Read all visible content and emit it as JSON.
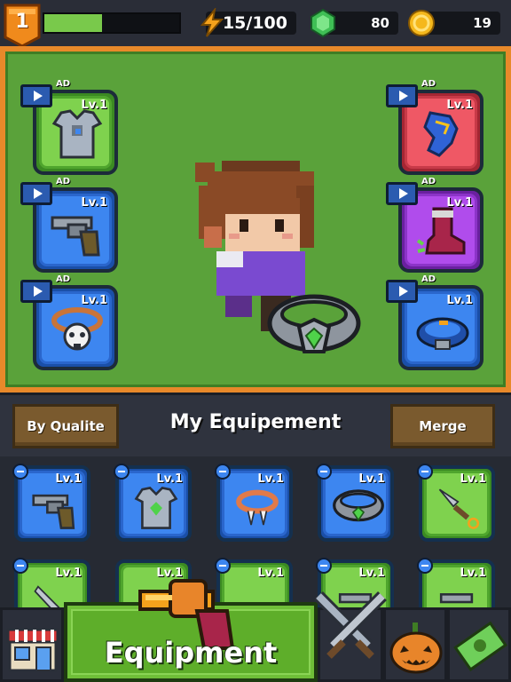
{
  "player": {
    "level": "1",
    "xp_progress": 0.43
  },
  "resources": {
    "energy": {
      "value": "15/100",
      "icon": "lightning-icon"
    },
    "gems": {
      "value": "80",
      "icon": "green-gem-icon"
    },
    "coins": {
      "value": "19",
      "icon": "gold-coin-icon"
    }
  },
  "arena": {
    "ad_label": "AD",
    "left_slots": [
      {
        "level": "Lv.1",
        "rarity": "green",
        "item": "armor-vest-icon",
        "ad": true
      },
      {
        "level": "Lv.1",
        "rarity": "blue",
        "item": "revolver-icon",
        "ad": true
      },
      {
        "level": "Lv.1",
        "rarity": "blue",
        "item": "skull-necklace-icon",
        "ad": true
      }
    ],
    "right_slots": [
      {
        "level": "Lv.1",
        "rarity": "red",
        "item": "glove-icon",
        "ad": true
      },
      {
        "level": "Lv.1",
        "rarity": "purple",
        "item": "boot-icon",
        "ad": true
      },
      {
        "level": "Lv.1",
        "rarity": "blue",
        "item": "belt-icon",
        "ad": true
      }
    ]
  },
  "equipment_header": {
    "sort_button": "By Qualite",
    "title": "My Equipement",
    "merge_button": "Merge"
  },
  "inventory": [
    {
      "level": "Lv.1",
      "rarity": "blue",
      "item": "revolver-icon"
    },
    {
      "level": "Lv.1",
      "rarity": "blue",
      "item": "armor-vest-icon"
    },
    {
      "level": "Lv.1",
      "rarity": "blue",
      "item": "fang-necklace-icon"
    },
    {
      "level": "Lv.1",
      "rarity": "blue",
      "item": "gem-ring-icon"
    },
    {
      "level": "Lv.1",
      "rarity": "green",
      "item": "kunai-icon"
    },
    {
      "level": "Lv.1",
      "rarity": "green",
      "item": "blade-icon"
    },
    {
      "level": "Lv.1",
      "rarity": "green",
      "item": "item-icon"
    },
    {
      "level": "Lv.1",
      "rarity": "green",
      "item": "item-icon"
    },
    {
      "level": "Lv.1",
      "rarity": "green",
      "item": "gun-icon"
    },
    {
      "level": "Lv.1",
      "rarity": "green",
      "item": "gun-icon"
    }
  ],
  "bottom_nav": {
    "equipment_label": "Equipment",
    "tabs": [
      "shop-icon",
      "equipment-tab",
      "crossed-swords-icon",
      "pumpkin-icon",
      "cash-icon"
    ]
  },
  "colors": {
    "arena_green": "#5aa23a",
    "arena_border": "#e8892a",
    "rarity_blue": "#3d86f0",
    "rarity_green": "#7fd24e",
    "rarity_red": "#ef5865",
    "rarity_purple": "#b04cec",
    "button_tan": "#7a5a2e"
  }
}
